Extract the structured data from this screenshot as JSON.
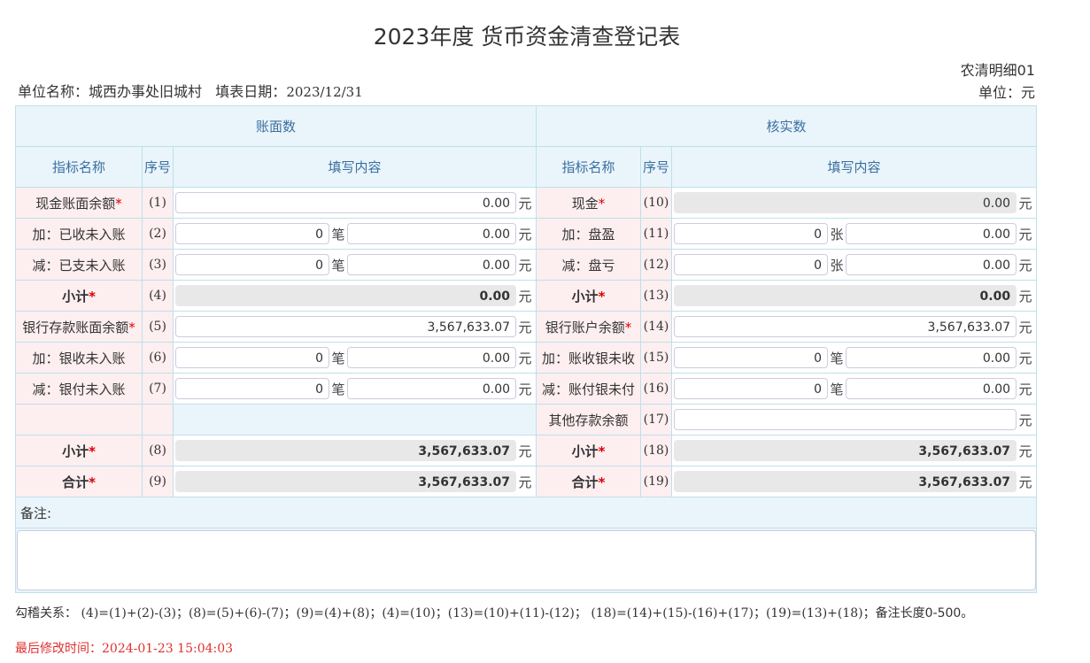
{
  "title": "2023年度 货币资金清查登记表",
  "form_code": "农清明细01",
  "unit_label": "单位：元",
  "org": {
    "label": "单位名称：",
    "value": "城西办事处旧城村",
    "date_label": "填表日期：",
    "date": "2023/12/31"
  },
  "headers": {
    "book": "账面数",
    "verify": "核实数",
    "name": "指标名称",
    "seq": "序号",
    "content": "填写内容"
  },
  "units": {
    "yuan": "元",
    "bi": "笔",
    "zhang": "张"
  },
  "left_rows": [
    {
      "name": "现金账面余额",
      "req": "*",
      "seq": "(1)",
      "amount": "0.00"
    },
    {
      "name": "加：已收未入账",
      "seq": "(2)",
      "count": "0",
      "amount": "0.00"
    },
    {
      "name": "减：已支未入账",
      "seq": "(3)",
      "count": "0",
      "amount": "0.00"
    },
    {
      "name": "小计",
      "req": "*",
      "seq": "(4)",
      "amount": "0.00"
    },
    {
      "name": "银行存款账面余额",
      "req": "*",
      "seq": "(5)",
      "amount": "3,567,633.07"
    },
    {
      "name": "加：银收未入账",
      "seq": "(6)",
      "count": "0",
      "amount": "0.00"
    },
    {
      "name": "减：银付未入账",
      "seq": "(7)",
      "count": "0",
      "amount": "0.00"
    },
    {
      "name": "小计",
      "req": "*",
      "seq": "(8)",
      "amount": "3,567,633.07"
    },
    {
      "name": "合计",
      "req": "*",
      "seq": "(9)",
      "amount": "3,567,633.07"
    }
  ],
  "right_rows": [
    {
      "name": "现金",
      "req": "*",
      "seq": "(10)",
      "amount": "0.00"
    },
    {
      "name": "加：盘盈",
      "seq": "(11)",
      "count": "0",
      "amount": "0.00"
    },
    {
      "name": "减：盘亏",
      "seq": "(12)",
      "count": "0",
      "amount": "0.00"
    },
    {
      "name": "小计",
      "req": "*",
      "seq": "(13)",
      "amount": "0.00"
    },
    {
      "name": "银行账户余额",
      "req": "*",
      "seq": "(14)",
      "amount": "3,567,633.07"
    },
    {
      "name": "加：账收银未收",
      "seq": "(15)",
      "count": "0",
      "amount": "0.00"
    },
    {
      "name": "减：账付银未付",
      "seq": "(16)",
      "count": "0",
      "amount": "0.00"
    },
    {
      "name": "其他存款余额",
      "seq": "(17)",
      "amount": ""
    },
    {
      "name": "小计",
      "req": "*",
      "seq": "(18)",
      "amount": "3,567,633.07"
    },
    {
      "name": "合计",
      "req": "*",
      "seq": "(19)",
      "amount": "3,567,633.07"
    }
  ],
  "remark": {
    "label": "备注:",
    "value": ""
  },
  "formula": {
    "label": "勾稽关系：",
    "text": " (4)=(1)+(2)-(3)；(8)=(5)+(6)-(7)；(9)=(4)+(8)；(4)=(10)；(13)=(10)+(11)-(12)； (18)=(14)+(15)-(16)+(17)；(19)=(13)+(18)；",
    "tail": "备注长度0-500。"
  },
  "modified": {
    "label": "最后修改时间：",
    "time": "2024-01-23 15:04:03"
  }
}
